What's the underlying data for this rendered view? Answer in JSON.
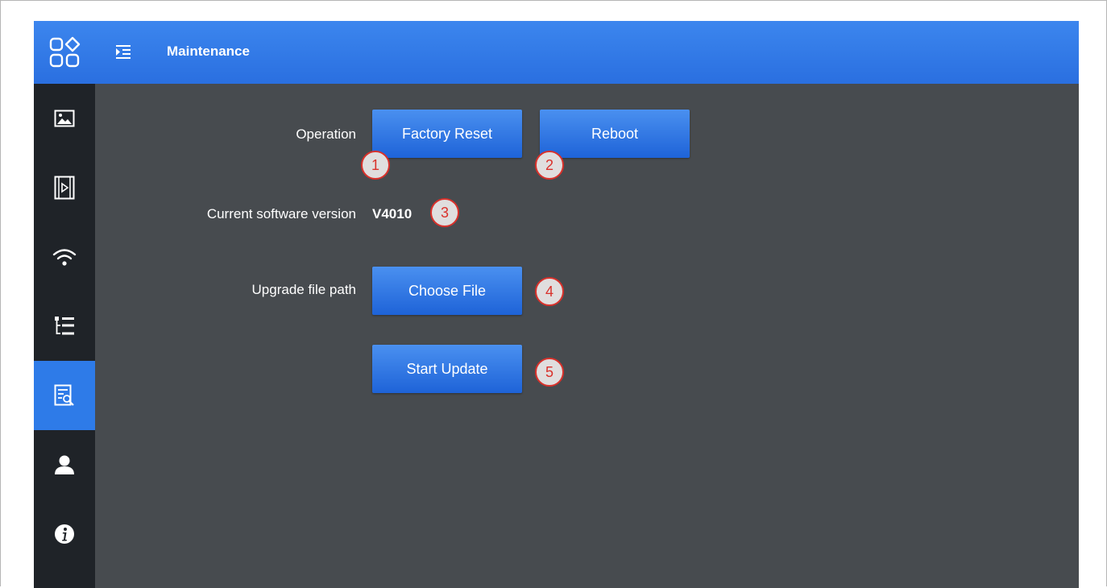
{
  "header": {
    "title": "Maintenance",
    "logo_icon": "apps-grid-icon",
    "menu_icon": "menu-indent-icon",
    "background": "#2f78e8"
  },
  "sidebar": {
    "items": [
      {
        "icon": "image-icon",
        "active": false
      },
      {
        "icon": "video-icon",
        "active": false
      },
      {
        "icon": "wifi-icon",
        "active": false
      },
      {
        "icon": "list-tree-icon",
        "active": false
      },
      {
        "icon": "maintenance-icon",
        "active": true
      },
      {
        "icon": "user-icon",
        "active": false
      },
      {
        "icon": "info-icon",
        "active": false
      }
    ],
    "active_color": "#2e7be8"
  },
  "main": {
    "operation_label": "Operation",
    "factory_reset_label": "Factory Reset",
    "reboot_label": "Reboot",
    "version_label": "Current software version",
    "version_value": "V4010",
    "upgrade_path_label": "Upgrade file path",
    "choose_file_label": "Choose File",
    "start_update_label": "Start Update"
  },
  "markers": [
    "1",
    "2",
    "3",
    "4",
    "5"
  ],
  "colors": {
    "content_background": "#474b4f",
    "button_blue": "#2a74e4",
    "marker_red": "#d9312b"
  }
}
